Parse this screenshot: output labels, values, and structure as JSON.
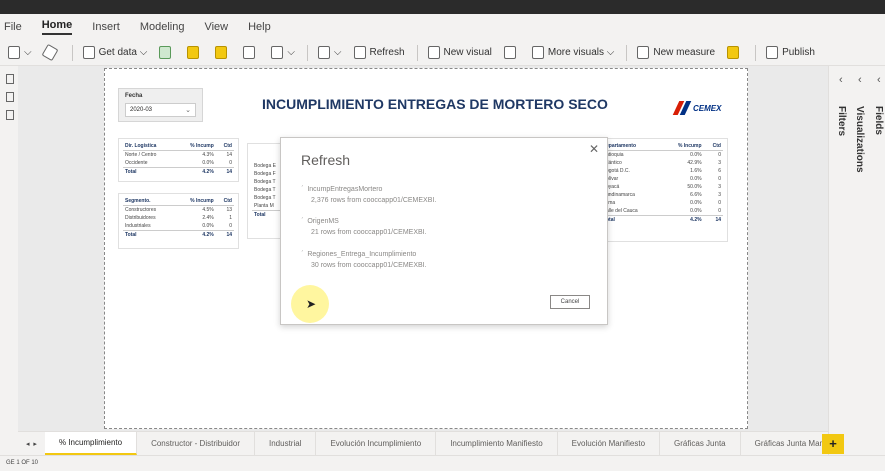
{
  "menu": [
    "File",
    "Home",
    "Insert",
    "Modeling",
    "View",
    "Help"
  ],
  "ribbon": {
    "get_data": "Get data",
    "refresh": "Refresh",
    "new_visual": "New visual",
    "more_visuals": "More visuals",
    "new_measure": "New measure",
    "publish": "Publish"
  },
  "panes": {
    "filters": "Filters",
    "visualizations": "Visualizations",
    "fields": "Fields"
  },
  "slicer": {
    "title": "Fecha",
    "value": "2020-03"
  },
  "report_title": "INCUMPLIMIENTO ENTREGAS DE MORTERO SECO",
  "logo_text": "CEMEX",
  "table_dir": {
    "headers": [
      "Dir. Logística",
      "% Incump",
      "Ctd"
    ],
    "rows": [
      [
        "Norte / Centro",
        "4.3%",
        "14"
      ],
      [
        "Occidente",
        "0.0%",
        "0"
      ]
    ],
    "total": [
      "Total",
      "4.2%",
      "14"
    ]
  },
  "table_seg": {
    "headers": [
      "Segmento.",
      "% Incump",
      "Ctd"
    ],
    "rows": [
      [
        "Constructores",
        "4.5%",
        "13"
      ],
      [
        "Distribuidores",
        "2.4%",
        "1"
      ],
      [
        "Industriales",
        "0.0%",
        "0"
      ]
    ],
    "total": [
      "Total",
      "4.2%",
      "14"
    ]
  },
  "table_bodega": {
    "rows": [
      "Bodega E",
      "Bodega F",
      "Bodega T",
      "Bodega T",
      "Bodega T",
      "Planta M"
    ],
    "total": "Total"
  },
  "table_depto": {
    "headers": [
      "epartamento",
      "% Incump",
      "Ctd"
    ],
    "rows": [
      [
        "ntioquia",
        "0.0%",
        "0"
      ],
      [
        "tlántico",
        "42.9%",
        "3"
      ],
      [
        "ogotá D.C.",
        "1.6%",
        "6"
      ],
      [
        "olívar",
        "0.0%",
        "0"
      ],
      [
        "oyacá",
        "50.0%",
        "3"
      ],
      [
        "undinamarca",
        "6.6%",
        "3"
      ],
      [
        "lima",
        "0.0%",
        "0"
      ],
      [
        "alle del Cauca",
        "0.0%",
        "0"
      ]
    ],
    "total": [
      "otal",
      "4.2%",
      "14"
    ]
  },
  "dialog": {
    "title": "Refresh",
    "items": [
      {
        "name": "IncumpEntregasMortero",
        "detail": "2,376 rows from cooccapp01/CEMEXBI."
      },
      {
        "name": "OrigenMS",
        "detail": "21 rows from cooccapp01/CEMEXBI."
      },
      {
        "name": "Regiones_Entrega_Incumplimiento",
        "detail": "30 rows from cooccapp01/CEMEXBI."
      }
    ],
    "cancel": "Cancel"
  },
  "tabs": [
    "% Incumplimiento",
    "Constructor - Distribuidor",
    "Industrial",
    "Evolución Incumplimiento",
    "Incumplimiento Manifiesto",
    "Evolución Manifiesto",
    "Gráficas Junta",
    "Gráficas Junta Man"
  ],
  "status": "GE 1 OF 10"
}
